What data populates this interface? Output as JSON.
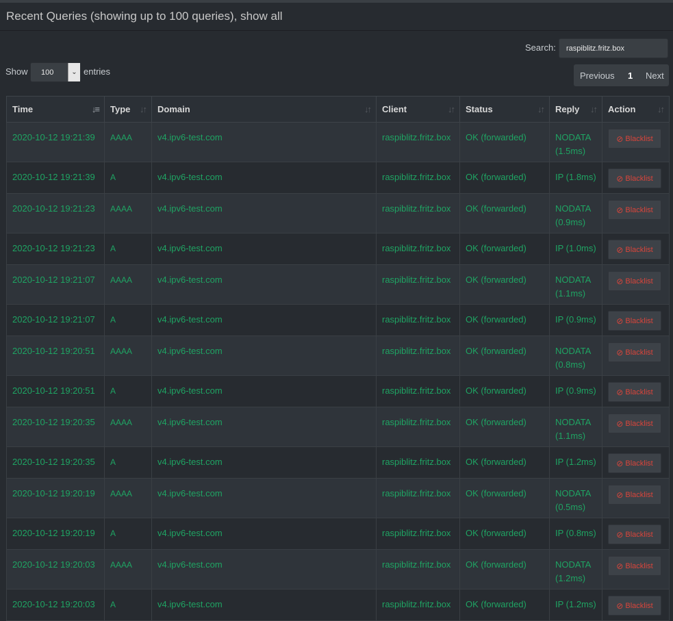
{
  "header": {
    "title": "Recent Queries (showing up to 100 queries), show all"
  },
  "search": {
    "label": "Search:",
    "value": "raspiblitz.fritz.box"
  },
  "entries": {
    "show_label": "Show",
    "value": "100",
    "suffix_label": "entries"
  },
  "pagination": {
    "previous": "Previous",
    "current": "1",
    "next": "Next"
  },
  "table": {
    "columns": [
      "Time",
      "Type",
      "Domain",
      "Client",
      "Status",
      "Reply",
      "Action"
    ],
    "action_label": "Blacklist",
    "rows": [
      {
        "time": "2020-10-12 19:21:39",
        "type": "AAAA",
        "domain": "v4.ipv6-test.com",
        "client": "raspiblitz.fritz.box",
        "status": "OK (forwarded)",
        "reply": "NODATA (1.5ms)"
      },
      {
        "time": "2020-10-12 19:21:39",
        "type": "A",
        "domain": "v4.ipv6-test.com",
        "client": "raspiblitz.fritz.box",
        "status": "OK (forwarded)",
        "reply": "IP (1.8ms)"
      },
      {
        "time": "2020-10-12 19:21:23",
        "type": "AAAA",
        "domain": "v4.ipv6-test.com",
        "client": "raspiblitz.fritz.box",
        "status": "OK (forwarded)",
        "reply": "NODATA (0.9ms)"
      },
      {
        "time": "2020-10-12 19:21:23",
        "type": "A",
        "domain": "v4.ipv6-test.com",
        "client": "raspiblitz.fritz.box",
        "status": "OK (forwarded)",
        "reply": "IP (1.0ms)"
      },
      {
        "time": "2020-10-12 19:21:07",
        "type": "AAAA",
        "domain": "v4.ipv6-test.com",
        "client": "raspiblitz.fritz.box",
        "status": "OK (forwarded)",
        "reply": "NODATA (1.1ms)"
      },
      {
        "time": "2020-10-12 19:21:07",
        "type": "A",
        "domain": "v4.ipv6-test.com",
        "client": "raspiblitz.fritz.box",
        "status": "OK (forwarded)",
        "reply": "IP (0.9ms)"
      },
      {
        "time": "2020-10-12 19:20:51",
        "type": "AAAA",
        "domain": "v4.ipv6-test.com",
        "client": "raspiblitz.fritz.box",
        "status": "OK (forwarded)",
        "reply": "NODATA (0.8ms)"
      },
      {
        "time": "2020-10-12 19:20:51",
        "type": "A",
        "domain": "v4.ipv6-test.com",
        "client": "raspiblitz.fritz.box",
        "status": "OK (forwarded)",
        "reply": "IP (0.9ms)"
      },
      {
        "time": "2020-10-12 19:20:35",
        "type": "AAAA",
        "domain": "v4.ipv6-test.com",
        "client": "raspiblitz.fritz.box",
        "status": "OK (forwarded)",
        "reply": "NODATA (1.1ms)"
      },
      {
        "time": "2020-10-12 19:20:35",
        "type": "A",
        "domain": "v4.ipv6-test.com",
        "client": "raspiblitz.fritz.box",
        "status": "OK (forwarded)",
        "reply": "IP (1.2ms)"
      },
      {
        "time": "2020-10-12 19:20:19",
        "type": "AAAA",
        "domain": "v4.ipv6-test.com",
        "client": "raspiblitz.fritz.box",
        "status": "OK (forwarded)",
        "reply": "NODATA (0.5ms)"
      },
      {
        "time": "2020-10-12 19:20:19",
        "type": "A",
        "domain": "v4.ipv6-test.com",
        "client": "raspiblitz.fritz.box",
        "status": "OK (forwarded)",
        "reply": "IP (0.8ms)"
      },
      {
        "time": "2020-10-12 19:20:03",
        "type": "AAAA",
        "domain": "v4.ipv6-test.com",
        "client": "raspiblitz.fritz.box",
        "status": "OK (forwarded)",
        "reply": "NODATA (1.2ms)"
      },
      {
        "time": "2020-10-12 19:20:03",
        "type": "A",
        "domain": "v4.ipv6-test.com",
        "client": "raspiblitz.fritz.box",
        "status": "OK (forwarded)",
        "reply": "IP (1.2ms)"
      }
    ]
  },
  "colors": {
    "query_text": "#1fa463",
    "blacklist_text": "#d9453b",
    "background": "#272b30"
  }
}
